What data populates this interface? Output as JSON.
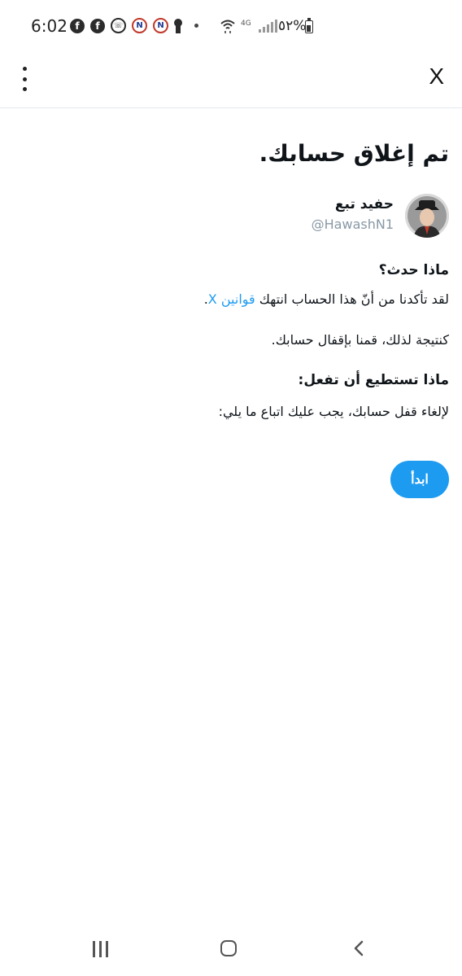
{
  "status_bar": {
    "time": "6:02",
    "notification_icons": [
      "facebook-icon",
      "facebook-icon",
      "whatsapp-icon",
      "app-n-icon",
      "app-n-icon",
      "keyhole-icon",
      "more-dot-icon"
    ],
    "fb_glyph": "f",
    "wa_glyph": "☏",
    "n_glyph": "N",
    "volte": "4G",
    "battery": "٥٢%"
  },
  "header": {
    "logo": "X"
  },
  "content": {
    "title": "تم إغلاق حسابك.",
    "display_name": "حفيد تبع",
    "handle": "@HawashN1",
    "section1_heading": "ماذا حدث؟",
    "para1_text": "لقد تأكدنا من أنّ هذا الحساب انتهك",
    "para1_link": "قوانين X",
    "para1_end": ".",
    "para2": "كنتيجة لذلك، قمنا بإقفال حسابك.",
    "section2_heading": "ماذا تستطيع أن تفعل:",
    "para3": "لإلغاء قفل حسابك، يجب عليك اتباع ما يلي:",
    "start_button": "ابدأ"
  },
  "colors": {
    "accent": "#1d9bf0",
    "text": "#0f1419",
    "muted": "#8899a6"
  }
}
